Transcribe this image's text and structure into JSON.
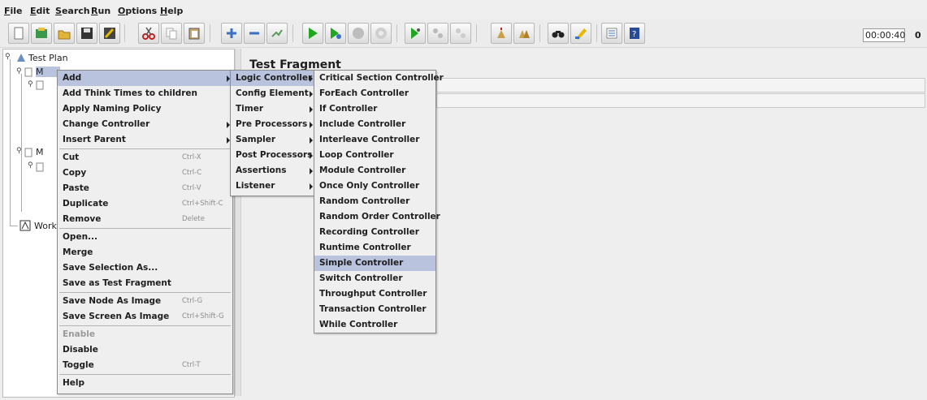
{
  "menubar": {
    "file": "File",
    "edit": "Edit",
    "search": "Search",
    "run": "Run",
    "options": "Options",
    "help": "Help"
  },
  "toolbar": {
    "timer": "00:00:40",
    "counter": "0"
  },
  "tree": {
    "root": "Test Plan",
    "node1_partial": "M",
    "node2_partial": "M",
    "workbench_partial": "Work"
  },
  "right_panel": {
    "title": "Test Fragment"
  },
  "context_menu": {
    "add": "Add",
    "add_think_times": "Add Think Times to children",
    "apply_naming": "Apply Naming Policy",
    "change_controller": "Change Controller",
    "insert_parent": "Insert Parent",
    "cut": "Cut",
    "cut_sc": "Ctrl-X",
    "copy": "Copy",
    "copy_sc": "Ctrl-C",
    "paste": "Paste",
    "paste_sc": "Ctrl-V",
    "duplicate": "Duplicate",
    "duplicate_sc": "Ctrl+Shift-C",
    "remove": "Remove",
    "remove_sc": "Delete",
    "open": "Open...",
    "merge": "Merge",
    "save_selection": "Save Selection As...",
    "save_fragment": "Save as Test Fragment",
    "save_node_image": "Save Node As Image",
    "save_node_image_sc": "Ctrl-G",
    "save_screen_image": "Save Screen As Image",
    "save_screen_image_sc": "Ctrl+Shift-G",
    "enable": "Enable",
    "disable": "Disable",
    "toggle": "Toggle",
    "toggle_sc": "Ctrl-T",
    "help": "Help"
  },
  "add_menu": {
    "logic_controller": "Logic Controller",
    "config_element": "Config Element",
    "timer": "Timer",
    "pre_processors": "Pre Processors",
    "sampler": "Sampler",
    "post_processors": "Post Processors",
    "assertions": "Assertions",
    "listener": "Listener"
  },
  "logic_menu": {
    "items": [
      "Critical Section Controller",
      "ForEach Controller",
      "If Controller",
      "Include Controller",
      "Interleave Controller",
      "Loop Controller",
      "Module Controller",
      "Once Only Controller",
      "Random Controller",
      "Random Order Controller",
      "Recording Controller",
      "Runtime Controller",
      "Simple Controller",
      "Switch Controller",
      "Throughput Controller",
      "Transaction Controller",
      "While Controller"
    ],
    "highlighted": "Simple Controller"
  }
}
